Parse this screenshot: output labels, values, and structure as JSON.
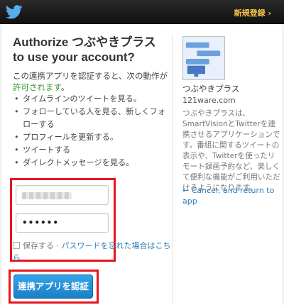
{
  "header": {
    "signup": "新規登録 ›"
  },
  "auth": {
    "title": "Authorize つぶやきプラス to use your account?",
    "intro_prefix": "この連携アプリを認証すると、次の動作が",
    "intro_highlight": "許可されます",
    "intro_suffix": "。",
    "permissions": [
      "タイムラインのツイートを見る。",
      "フォローしている人を見る、新しくフォローする",
      "プロフィールを更新する。",
      "ツイートする",
      "ダイレクトメッセージを見る。"
    ],
    "password_value": "••••••",
    "remember_label": "保存する",
    "separator": " · ",
    "forgot_link": "パスワードを忘れた場合はこちら",
    "authorize_button": "連携アプリを認証"
  },
  "app": {
    "name": "つぶやきプラス",
    "url": "121ware.com",
    "description": "つぶやきプラスは、SmartVisionとTwitterを連携させるアプリケーションです。番組に関するツイートの表示や、Twitterを使ったリモート録画予約など、楽しくて便利な機能がご利用いただけるようになります。",
    "cancel_link": "← Cancel, and return to app"
  },
  "colors": {
    "accent_blue": "#2b7bb9",
    "highlight_red": "#e8141e",
    "allowed_green": "#3a9a2e",
    "header_gold": "#f7c548"
  }
}
